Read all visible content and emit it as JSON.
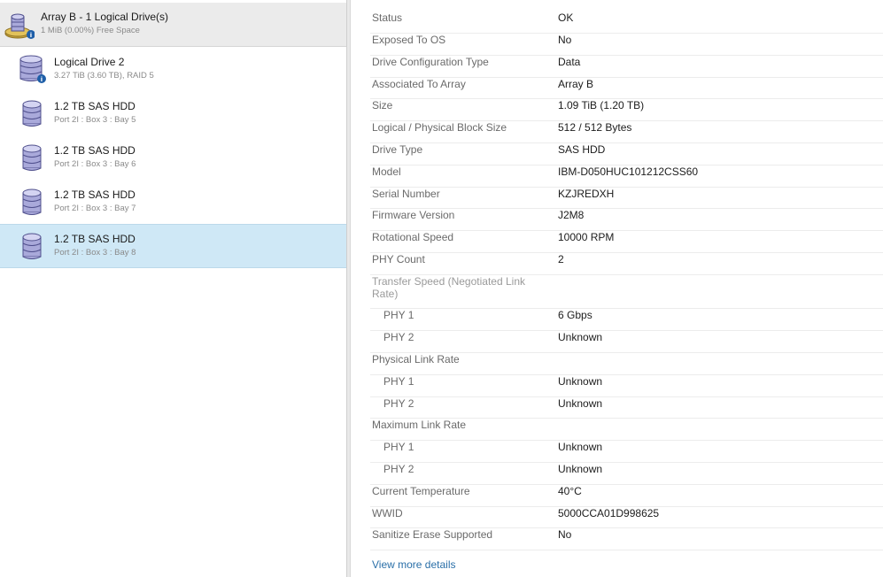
{
  "tree": {
    "items": [
      {
        "type": "array",
        "title": "Array B - 1 Logical Drive(s)",
        "subtitle": "1 MiB (0.00%) Free Space",
        "icon": "array-drive-icon"
      },
      {
        "type": "logical",
        "title": "Logical Drive 2",
        "subtitle": "3.27 TiB (3.60 TB), RAID 5",
        "icon": "logical-drive-icon"
      },
      {
        "type": "physical",
        "title": "1.2 TB SAS HDD",
        "subtitle": "Port 2I : Box 3 : Bay 5",
        "icon": "physical-drive-icon"
      },
      {
        "type": "physical",
        "title": "1.2 TB SAS HDD",
        "subtitle": "Port 2I : Box 3 : Bay 6",
        "icon": "physical-drive-icon"
      },
      {
        "type": "physical",
        "title": "1.2 TB SAS HDD",
        "subtitle": "Port 2I : Box 3 : Bay 7",
        "icon": "physical-drive-icon"
      },
      {
        "type": "physical",
        "title": "1.2 TB SAS HDD",
        "subtitle": "Port 2I : Box 3 : Bay 8",
        "icon": "physical-drive-icon",
        "selected": true
      }
    ]
  },
  "details": {
    "properties": [
      {
        "label": "Status",
        "value": "OK"
      },
      {
        "label": "Exposed To OS",
        "value": "No"
      },
      {
        "label": "Drive Configuration Type",
        "value": "Data"
      },
      {
        "label": "Associated To Array",
        "value": "Array B"
      },
      {
        "label": "Size",
        "value": "1.09 TiB (1.20 TB)"
      },
      {
        "label": "Logical / Physical Block Size",
        "value": "512 / 512 Bytes"
      },
      {
        "label": "Drive Type",
        "value": "SAS HDD"
      },
      {
        "label": "Model",
        "value": "IBM-D050HUC101212CSS60"
      },
      {
        "label": "Serial Number",
        "value": "KZJREDXH"
      },
      {
        "label": "Firmware Version",
        "value": "J2M8"
      },
      {
        "label": "Rotational Speed",
        "value": "10000 RPM"
      },
      {
        "label": "PHY Count",
        "value": "2"
      },
      {
        "label": "Transfer Speed (Negotiated Link Rate)",
        "value": ""
      },
      {
        "label": "PHY 1",
        "value": "6 Gbps"
      },
      {
        "label": "PHY 2",
        "value": "Unknown"
      },
      {
        "label": "Physical Link Rate",
        "value": ""
      },
      {
        "label": "PHY 1",
        "value": "Unknown"
      },
      {
        "label": "PHY 2",
        "value": "Unknown"
      },
      {
        "label": "Maximum Link Rate",
        "value": ""
      },
      {
        "label": "PHY 1",
        "value": "Unknown"
      },
      {
        "label": "PHY 2",
        "value": "Unknown"
      },
      {
        "label": "Current Temperature",
        "value": "40°C"
      },
      {
        "label": "WWID",
        "value": "5000CCA01D998625"
      },
      {
        "label": "Sanitize Erase Supported",
        "value": "No"
      }
    ],
    "view_more_label": "View more details"
  },
  "colors": {
    "selected_row": "#cfe8f6",
    "array_row": "#ebebeb",
    "drive_icon": "#8e8ec8",
    "info_badge": "#1f5fa8",
    "link": "#2a6fa8"
  }
}
